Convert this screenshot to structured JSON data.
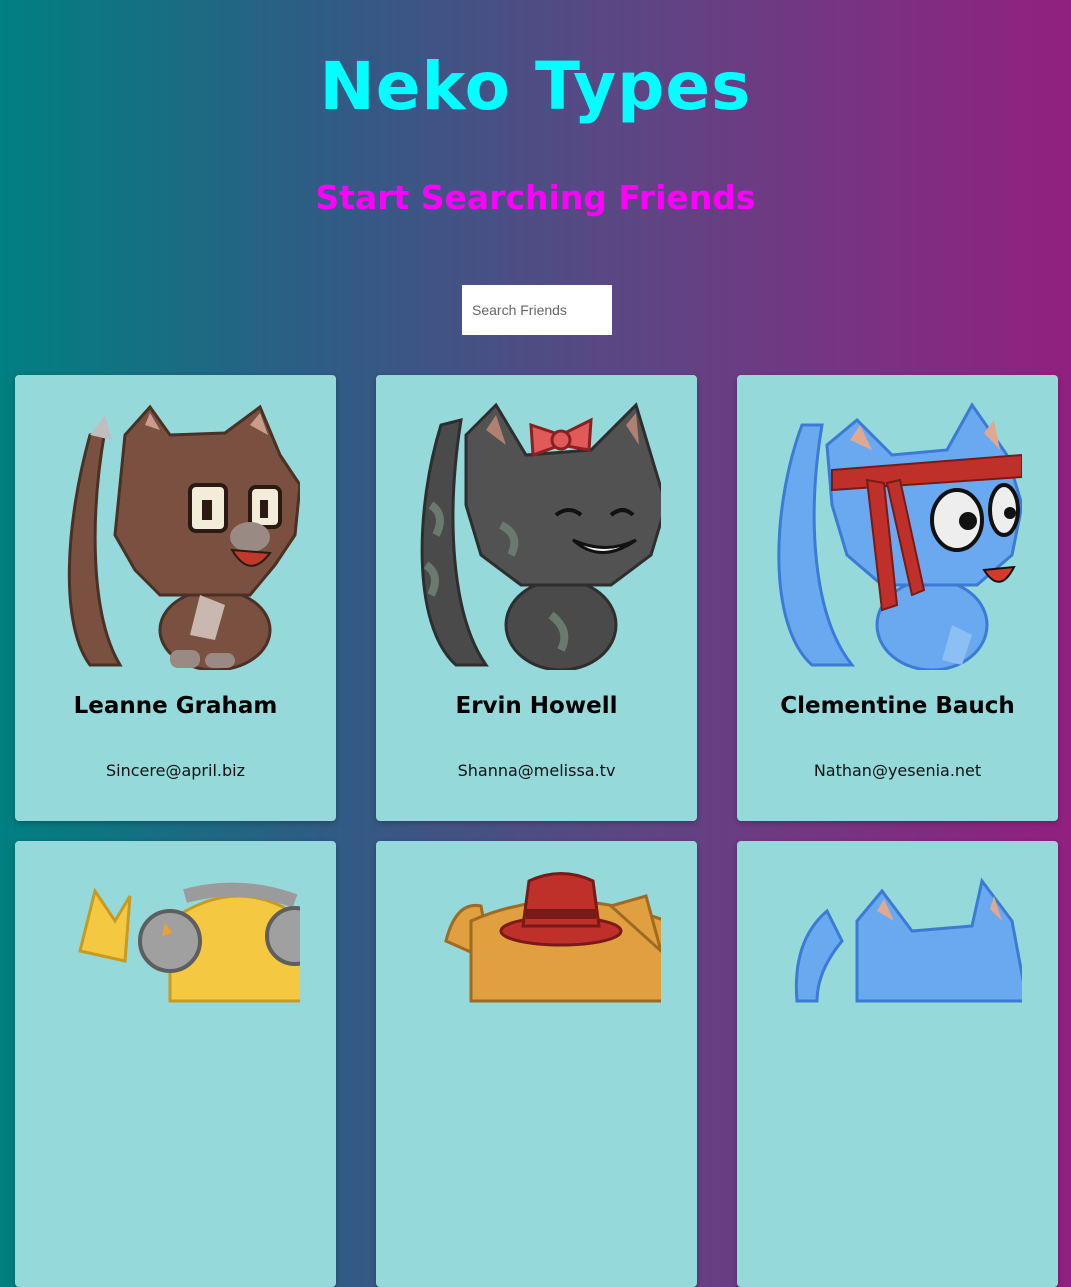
{
  "header": {
    "title": "Neko Types",
    "subtitle": "Start Searching Friends"
  },
  "search": {
    "placeholder": "Search Friends",
    "value": ""
  },
  "cards": [
    {
      "name": "Leanne Graham",
      "email": "Sincere@april.biz",
      "avatar": "brown-cat-icon"
    },
    {
      "name": "Ervin Howell",
      "email": "Shanna@melissa.tv",
      "avatar": "black-cat-with-bow-icon"
    },
    {
      "name": "Clementine Bauch",
      "email": "Nathan@yesenia.net",
      "avatar": "blue-cat-headband-icon"
    },
    {
      "name": "",
      "email": "",
      "avatar": "yellow-cat-headphones-icon"
    },
    {
      "name": "",
      "email": "",
      "avatar": "orange-cat-red-hat-icon"
    },
    {
      "name": "",
      "email": "",
      "avatar": "blue-cat-icon"
    }
  ],
  "colors": {
    "title": "#00ffff",
    "subtitle": "#ff00ff",
    "card_bg": "#95d9da"
  }
}
